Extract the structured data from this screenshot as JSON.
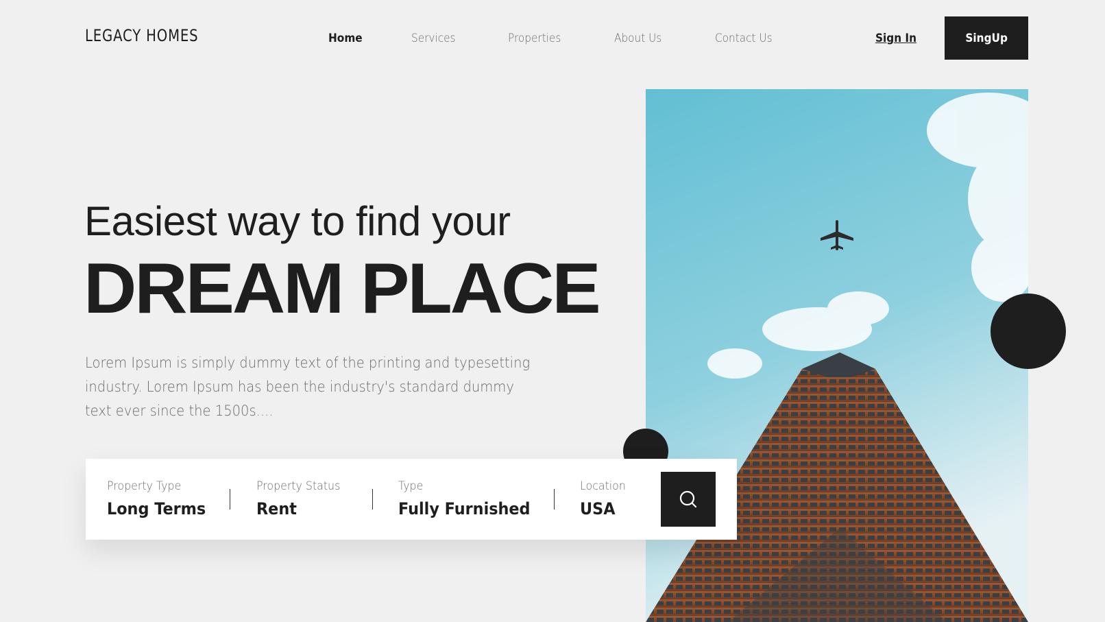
{
  "brand": {
    "logo_text": "LEGACY HOMES"
  },
  "nav": {
    "items": [
      {
        "label": "Home",
        "active": true
      },
      {
        "label": "Services"
      },
      {
        "label": "Properties"
      },
      {
        "label": "About Us"
      },
      {
        "label": "Contact Us"
      }
    ],
    "sign_in": "Sign In",
    "sign_up": "SingUp"
  },
  "hero": {
    "headline_line1": "Easiest way to find your",
    "headline_line2": "DREAM PLACE",
    "description": "Lorem Ipsum is simply dummy text of the printing and typesetting industry. Lorem Ipsum has been the industry's standard dummy text ever since the 1500s...."
  },
  "search": {
    "fields": [
      {
        "label": "Property Type",
        "value": "Long Terms"
      },
      {
        "label": "Property Status",
        "value": "Rent"
      },
      {
        "label": "Type",
        "value": "Fully Furnished"
      },
      {
        "label": "Location",
        "value": "USA"
      }
    ],
    "button_icon": "search-icon"
  },
  "colors": {
    "primary": "#1e1e1e",
    "background": "#f0f0f0",
    "muted_text": "#6b6b6b",
    "sky": "#6cc3d5"
  }
}
